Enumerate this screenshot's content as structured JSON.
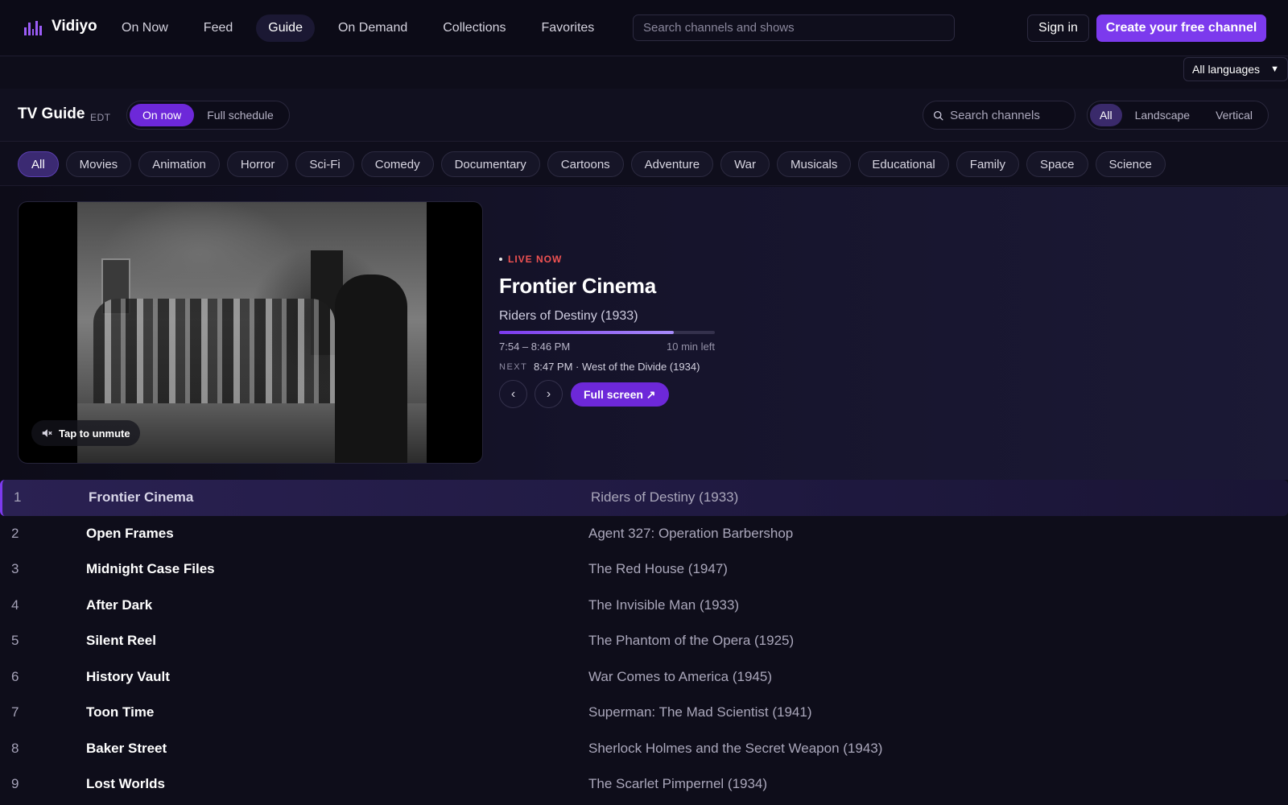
{
  "app": {
    "name": "Vidiyo"
  },
  "nav": {
    "links": [
      "On Now",
      "Feed",
      "Guide",
      "On Demand",
      "Collections",
      "Favorites"
    ],
    "active": "Guide",
    "search_placeholder": "Search channels and shows",
    "signin_label": "Sign in",
    "create_label": "Create your free channel"
  },
  "language": {
    "selected": "All languages"
  },
  "guide": {
    "title": "TV Guide",
    "timezone": "EDT",
    "view_modes": [
      "On now",
      "Full schedule"
    ],
    "active_view": "On now",
    "channel_search_placeholder": "Search channels",
    "orientations": [
      "All",
      "Landscape",
      "Vertical"
    ],
    "active_orientation": "All"
  },
  "categories": {
    "items": [
      "All",
      "Movies",
      "Animation",
      "Horror",
      "Sci-Fi",
      "Comedy",
      "Documentary",
      "Cartoons",
      "Adventure",
      "War",
      "Musicals",
      "Educational",
      "Family",
      "Space",
      "Science"
    ],
    "active": "All"
  },
  "hero": {
    "unmute_label": "Tap to unmute",
    "live_label": "LIVE NOW",
    "channel": "Frontier Cinema",
    "program": "Riders of Destiny (1933)",
    "progress": 0.81,
    "time_range": "7:54 – 8:46 PM",
    "time_left": "10 min left",
    "next_label": "NEXT",
    "next_info": "8:47 PM · West of the Divide (1934)",
    "prev_symbol": "‹",
    "next_symbol": "›",
    "fullscreen_label": "Full screen ↗"
  },
  "channels": [
    {
      "num": "1",
      "name": "Frontier Cinema",
      "show": "Riders of Destiny (1933)",
      "active": true
    },
    {
      "num": "2",
      "name": "Open Frames",
      "show": "Agent 327: Operation Barbershop"
    },
    {
      "num": "3",
      "name": "Midnight Case Files",
      "show": "The Red House (1947)"
    },
    {
      "num": "4",
      "name": "After Dark",
      "show": "The Invisible Man (1933)"
    },
    {
      "num": "5",
      "name": "Silent Reel",
      "show": "The Phantom of the Opera (1925)"
    },
    {
      "num": "6",
      "name": "History Vault",
      "show": "War Comes to America (1945)"
    },
    {
      "num": "7",
      "name": "Toon Time",
      "show": "Superman: The Mad Scientist (1941)"
    },
    {
      "num": "8",
      "name": "Baker Street",
      "show": "Sherlock Holmes and the Secret Weapon (1943)"
    },
    {
      "num": "9",
      "name": "Lost Worlds",
      "show": "The Scarlet Pimpernel (1934)"
    }
  ],
  "colors": {
    "accent": "#7c3aed",
    "live": "#f05252",
    "background": "#0e0d1a"
  }
}
